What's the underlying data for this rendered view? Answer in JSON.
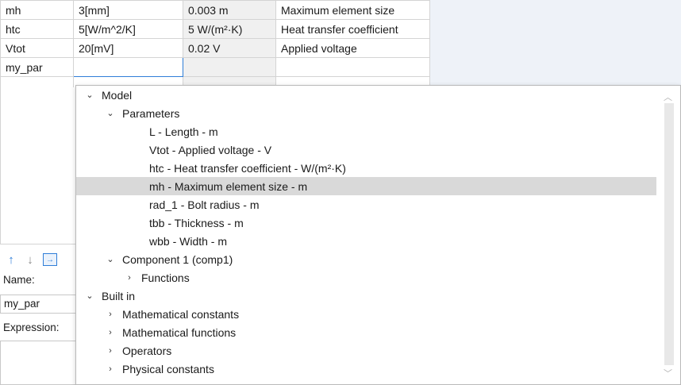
{
  "parameters": {
    "rows": [
      {
        "name": "mh",
        "expression": "3[mm]",
        "value": "0.003 m",
        "description": "Maximum element size"
      },
      {
        "name": "htc",
        "expression": "5[W/m^2/K]",
        "value": "5 W/(m²·K)",
        "description": "Heat transfer coefficient"
      },
      {
        "name": "Vtot",
        "expression": "20[mV]",
        "value": "0.02 V",
        "description": "Applied voltage"
      },
      {
        "name": "my_par",
        "expression": "",
        "value": "",
        "description": ""
      }
    ]
  },
  "settings": {
    "name_label": "Name:",
    "name_value": "my_par",
    "expression_label": "Expression:"
  },
  "popup": {
    "model_label": "Model",
    "parameters_label": "Parameters",
    "parameter_items": [
      "L - Length - m",
      "Vtot - Applied voltage - V",
      "htc - Heat transfer coefficient - W/(m²·K)",
      "mh - Maximum element size - m",
      "rad_1 - Bolt radius - m",
      "tbb - Thickness - m",
      "wbb - Width - m"
    ],
    "selected_item": "mh - Maximum element size - m",
    "component_label": "Component 1 (comp1)",
    "functions_label": "Functions",
    "builtin_label": "Built in",
    "builtin_items": [
      "Mathematical constants",
      "Mathematical functions",
      "Operators",
      "Physical constants"
    ]
  },
  "icons": {
    "expanded": "chevron-down-icon",
    "collapsed": "chevron-right-icon",
    "move_up": "arrow-up-icon",
    "move_down": "arrow-down-icon",
    "load": "load-from-file-icon"
  },
  "colors": {
    "accent": "#2f7ed8",
    "selection": "#d9d9d9",
    "panel_bg": "#eef2f8"
  }
}
